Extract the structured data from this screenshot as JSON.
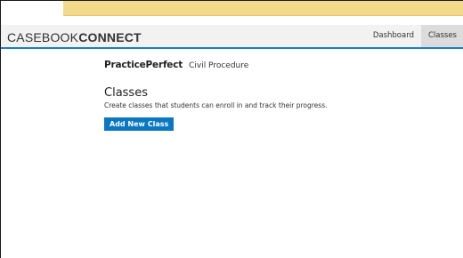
{
  "navbar": {
    "brand_light": "CASEBOOK",
    "brand_bold": "CONNECT",
    "links": [
      {
        "label": "Dashboard",
        "active": false
      },
      {
        "label": "Classes",
        "active": true
      }
    ]
  },
  "main": {
    "product_name": "PracticePerfect",
    "subject": "Civil Procedure",
    "title": "Classes",
    "description": "Create classes that students can enroll in and track their progress.",
    "add_button_label": "Add New Class"
  },
  "colors": {
    "accent": "#0a77c2",
    "banner": "#f3d98a",
    "navbar_bg": "#f2f2f2",
    "active_tab_bg": "#dcdcdc"
  }
}
